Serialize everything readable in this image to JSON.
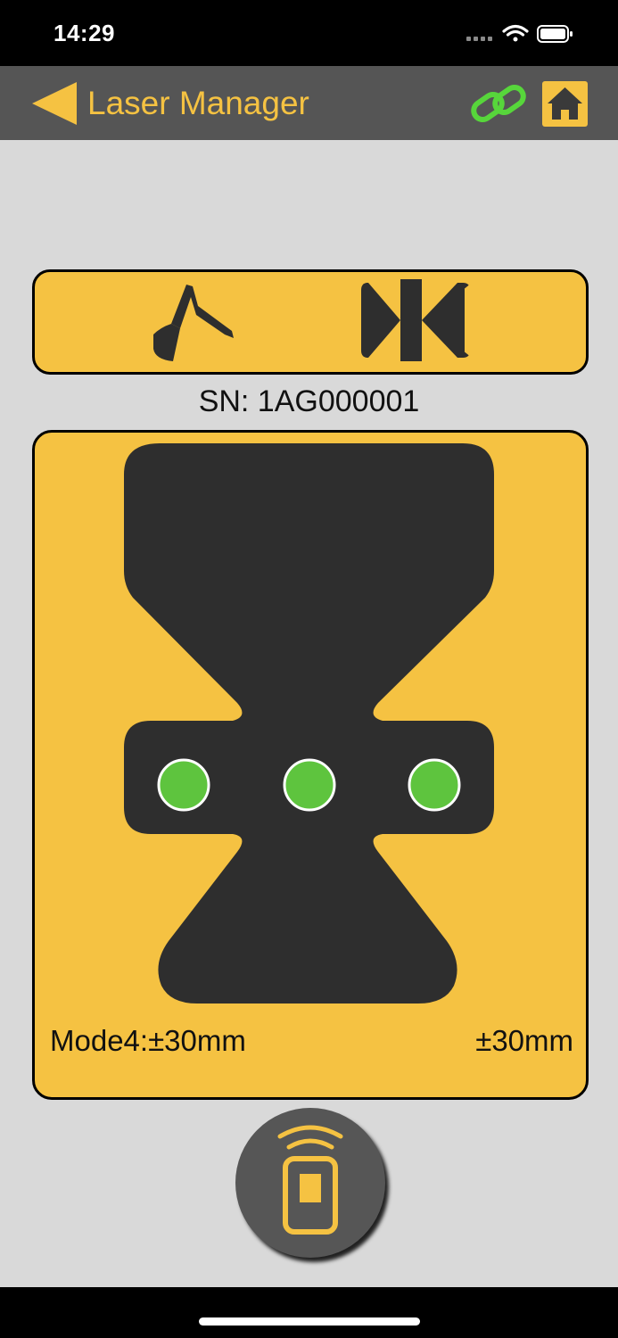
{
  "status_bar": {
    "time": "14:29",
    "icons": [
      "cellular-signal-icon",
      "wifi-icon",
      "battery-icon"
    ]
  },
  "nav": {
    "title": "Laser Manager",
    "back_icon": "back-arrow-icon",
    "link_icon": "link-icon",
    "home_icon": "home-icon"
  },
  "mode_selector": {
    "items": [
      {
        "name": "excavator-mode",
        "icon": "excavator-icon"
      },
      {
        "name": "receiver-mode",
        "icon": "receiver-icon"
      }
    ]
  },
  "device": {
    "serial_label": "SN: 1AG000001"
  },
  "display": {
    "leds": [
      "green",
      "green",
      "green"
    ],
    "mode_text": "Mode4:±30mm",
    "range_text": "±30mm"
  },
  "remote_button": {
    "icon": "remote-control-icon"
  },
  "colors": {
    "accent": "#f5c242",
    "nav_bg": "#555555",
    "content_bg": "#d9d9d9",
    "panel_dark": "#2e2e2e",
    "led_green": "#5ec43e",
    "link_green": "#57d63b"
  }
}
